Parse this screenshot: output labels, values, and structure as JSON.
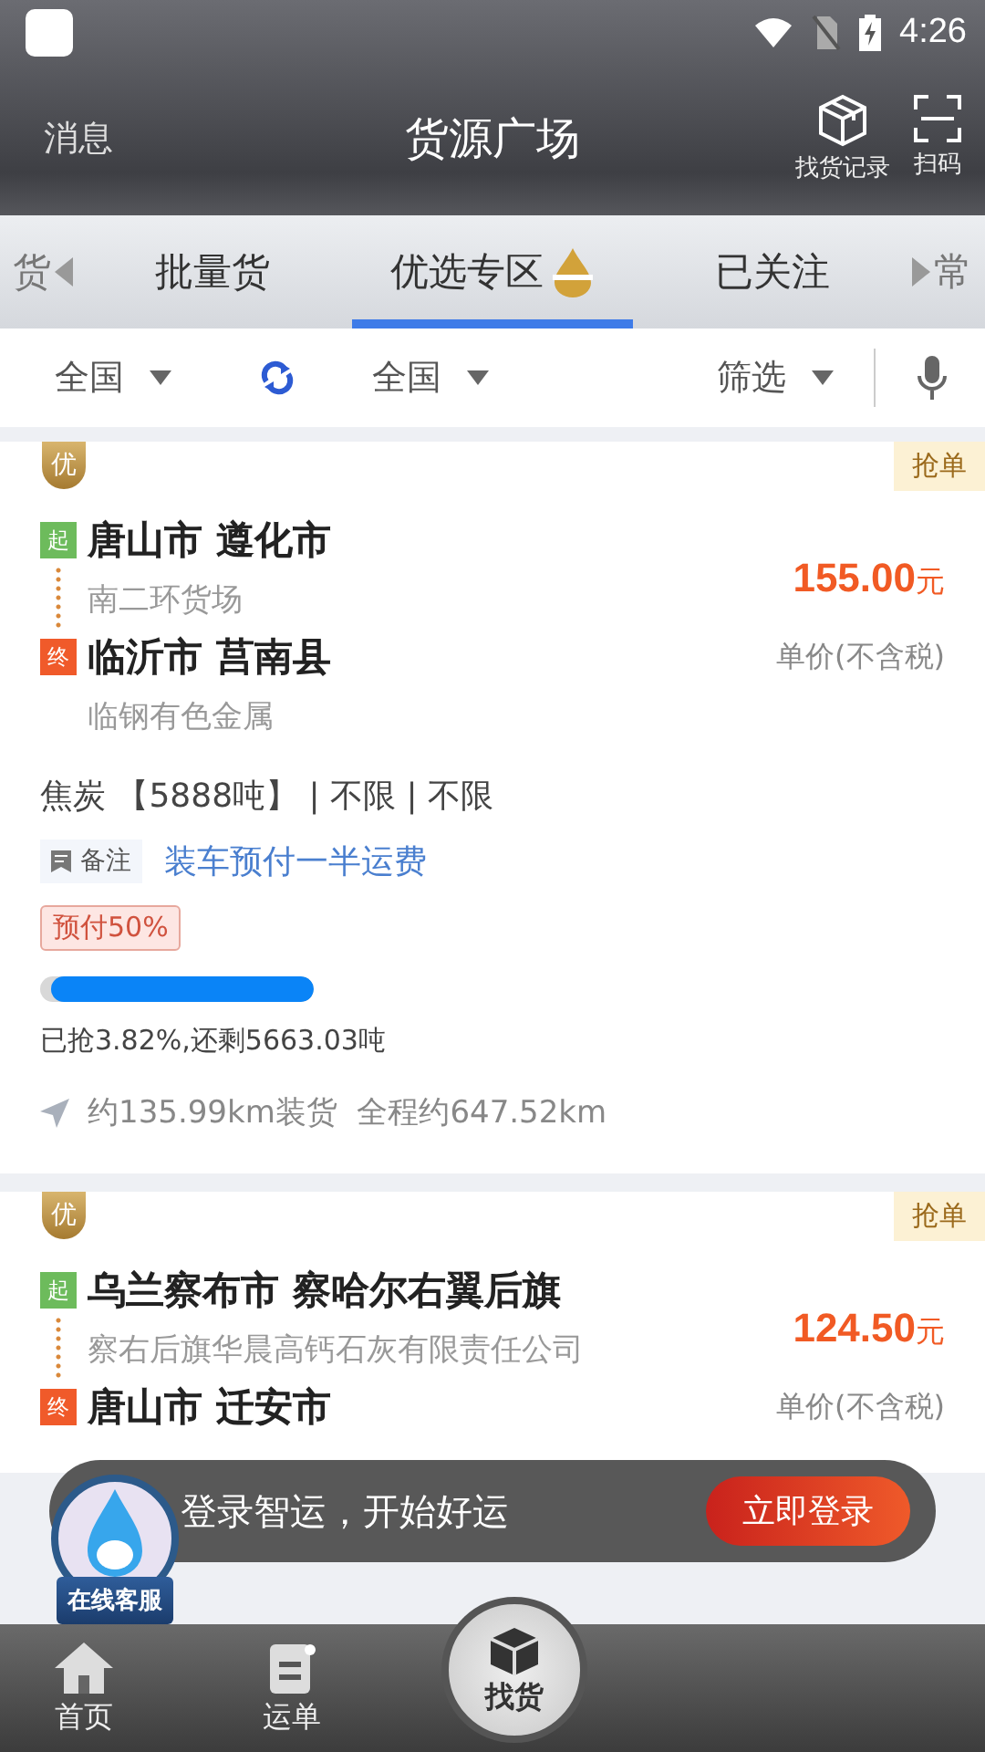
{
  "status_bar": {
    "time": "4:26"
  },
  "header": {
    "left": "消息",
    "title": "货源广场",
    "actions": [
      {
        "label": "找货记录",
        "kind": "box"
      },
      {
        "label": "扫码",
        "kind": "scan"
      }
    ]
  },
  "tabs": [
    {
      "label": "货",
      "selected": false,
      "kind": "edge-left"
    },
    {
      "label": "批量货",
      "selected": false,
      "kind": "normal"
    },
    {
      "label": "优选专区",
      "selected": true,
      "kind": "new"
    },
    {
      "label": "已关注",
      "selected": false,
      "kind": "normal"
    },
    {
      "label": "常",
      "selected": false,
      "kind": "edge-right"
    }
  ],
  "filters": {
    "from": "全国",
    "to": "全国",
    "filter": "筛选"
  },
  "cards": [
    {
      "badge": "优",
      "tag": "抢单",
      "origin": "唐山市 遵化市",
      "origin_mark": "起",
      "origin_place": "南二环货场",
      "dest": "临沂市 莒南县",
      "dest_mark": "终",
      "dest_place": "临钢有色金属",
      "price": "155.00",
      "unit": "元",
      "price_note": "单价(不含税)",
      "cargo": "焦炭 【5888吨】 | 不限 | 不限",
      "note_label": "备注",
      "note": "装车预付一半运费",
      "prepay": "预付50%",
      "level": 0.96,
      "progress_text": "已抢3.82%,还剩5663.03吨",
      "distance": "约135.99km装货  全程约647.52km"
    },
    {
      "badge": "优",
      "tag": "抢单",
      "origin": "乌兰察布市 察哈尔右翼后旗",
      "origin_mark": "起",
      "origin_place": "察右后旗华晨高钙石灰有限责任公司",
      "dest": "唐山市 迁安市",
      "dest_mark": "终",
      "price": "124.50",
      "unit": "元",
      "price_note": "单价(不含税)"
    }
  ],
  "toast": {
    "text": "登录智运，开始好运",
    "button": "立即登录"
  },
  "service": {
    "label": "在线客服"
  },
  "nav": [
    {
      "label": "首页",
      "kind": "home",
      "selected": false
    },
    {
      "label": "运单",
      "kind": "order",
      "selected": false
    },
    {
      "label": "找货",
      "kind": "center",
      "selected": true
    }
  ]
}
